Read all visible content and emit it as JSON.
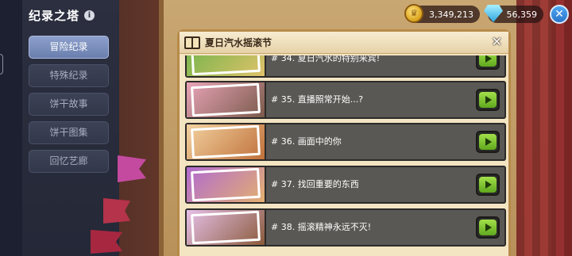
{
  "sidebar": {
    "title": "纪录之塔",
    "info_icon": "i",
    "items": [
      {
        "label": "冒险纪录",
        "active": true
      },
      {
        "label": "特殊纪录",
        "active": false
      },
      {
        "label": "饼干故事",
        "active": false
      },
      {
        "label": "饼干图集",
        "active": false
      },
      {
        "label": "回忆艺廊",
        "active": false
      }
    ]
  },
  "currency": {
    "coins": "3,349,213",
    "coin_icon": "coin-icon",
    "gems": "56,359",
    "gem_icon": "diamond-icon"
  },
  "top_close": "✕",
  "panel": {
    "title": "夏日汽水摇滚节",
    "close": "✕",
    "episodes": [
      {
        "label": "# 34. 夏日汽水的特别来宾!",
        "thumb_colors": [
          "#6fb44a",
          "#e0c26a"
        ]
      },
      {
        "label": "# 35. 直播照常开始...?",
        "thumb_colors": [
          "#e8a4b8",
          "#7a5a4a"
        ]
      },
      {
        "label": "# 36. 画面中的你",
        "thumb_colors": [
          "#f2d2a0",
          "#c0703a"
        ]
      },
      {
        "label": "# 37. 找回重要的东西",
        "thumb_colors": [
          "#b06ad0",
          "#e4b070"
        ]
      },
      {
        "label": "# 38. 摇滚精神永远不灭!",
        "thumb_colors": [
          "#e6c0e8",
          "#8a5a3a"
        ]
      }
    ]
  },
  "colors": {
    "play_green": "#7bc436",
    "active_nav": "#7b8fbf",
    "row_bg": "#5a5854"
  }
}
